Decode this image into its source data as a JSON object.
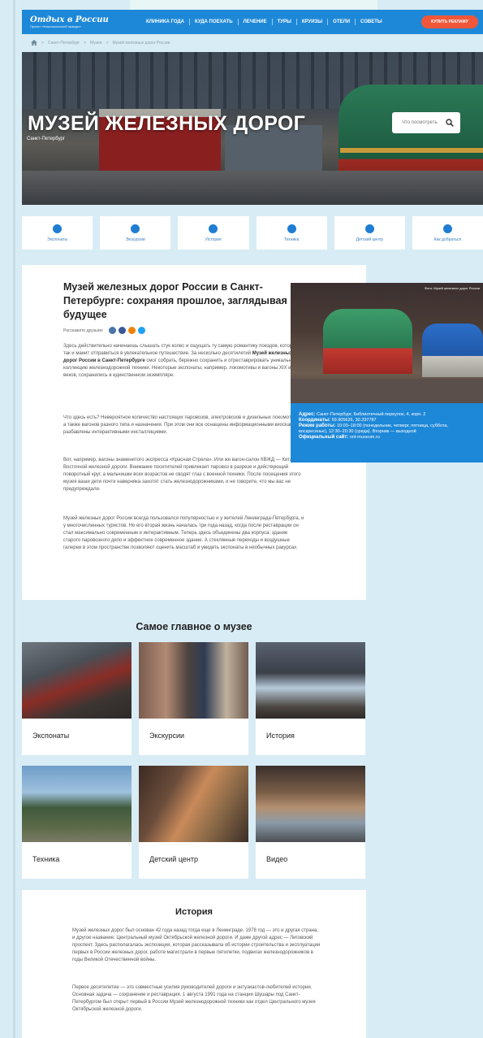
{
  "header": {
    "logo_title": "Отдых в России",
    "logo_sub": "Проект «Комсомольской правды»",
    "nav": [
      "КЛИНИКА ГОДА",
      "КУДА ПОЕХАТЬ",
      "ЛЕЧЕНИЕ",
      "ТУРЫ",
      "КРУИЗЫ",
      "ОТЕЛИ",
      "СОВЕТЫ"
    ],
    "ad_button": "КУПИТЬ РЕКЛАМУ"
  },
  "breadcrumbs": [
    "Санкт-Петербург",
    "Музеи",
    "Музей железных дорог России"
  ],
  "hero": {
    "title": "МУЗЕЙ ЖЕЛЕЗНЫХ ДОРОГ",
    "city": "Санкт-Петербург",
    "search_placeholder": "Что посмотреть"
  },
  "tiles": [
    "Экспонаты",
    "Экскурсии",
    "История",
    "Техника",
    "Детский центр",
    "Как добраться"
  ],
  "article": {
    "title": "Музей железных дорог России в Санкт-Петербурге: сохраняя прошлое, заглядывая в будущее",
    "share_label": "Расскажите друзьям:",
    "p1_start": "Здесь действительно начинаешь слышать стук колес и ощущать ту самую романтику поездов, которая так и манит отправиться в увлекательное путешествие. За несколько десятилетий ",
    "p1_bold": "Музей железных дорог России в Санкт-Петербурге",
    "p1_end": " смог собрать, бережно сохранить и отреставрировать уникальную коллекцию железнодорожной техники. Некоторые экспонаты, например, локомотивы и вагоны XIX и XX веков, сохранились в единственном экземпляре.",
    "p2": "Что здесь есть? Невероятное количество настоящих паровозов, электровозов и дизельных локомотивов, а также вагонов разного типа и назначения. При этом они все оснащены информационными киосками и разбавлены интерактивными инсталляциями.",
    "p3": "Вот, например, вагоны знаменитого экспресса «Красная Стрела». Или же вагон-салон КВЖД — Китайско-Восточной железной дороги. Внимание посетителей привлекает паровоз в разрезе и действующий поворотный круг, а мальчишки всех возрастов не сводят глаз с военной техники. После посещения этого музея ваши дети почти наверняка захотят стать железнодорожниками, и не говорите, что мы вас не предупреждали.",
    "p4": "Музей железных дорог России всегда пользовался популярностью и у жителей Ленинграда-Петербурга, и у многочисленных туристов. Но его вторая жизнь началась три года назад, когда после реставрации он стал максимально современным и интерактивным. Теперь здесь объединены два корпуса: здание старого паровозного депо и эффектное современное здание. А стеклянные переходы и воздушные галереи в этом пространстве позволяют оценить масштаб и увидеть экспонаты в необычных ракурсах."
  },
  "photo": {
    "caption": "Фото: Музей железных дорог России"
  },
  "info": {
    "address_label": "Адрес:",
    "address": "Санкт-Петербург, Библиотечный переулок, 4, корп. 2",
    "coords_label": "Координаты:",
    "coords": "59.905626, 30.297787",
    "hours_label": "Режим работы:",
    "hours": "10:00–18:00 (понедельник, четверг, пятница, суббота, воскресенье), 12:30–20:30 (среда). Вторник — выходной",
    "site_label": "Официальный сайт:",
    "site": "rzd-museum.ru"
  },
  "highlights": {
    "title": "Самое главное о музее",
    "cards": [
      "Экспонаты",
      "Экскурсии",
      "История",
      "Техника",
      "Детский центр",
      "Видео"
    ]
  },
  "history": {
    "title": "История",
    "p1": "Музей железных дорог был основан 42 года назад тогда еще в Ленинграде. 1978 год — это и другая страна, и другое название: Центральный музей Октябрьской железной дороги. И даже другой адрес — Лиговский проспект. Здесь располагалась экспозиция, которая рассказывала об истории строительства и эксплуатации первых в России железных дорог, работе магистрали в первые пятилетки, подвигах железнодорожников в годы Великой Отечественной войны.",
    "p2": "Первое десятилетие — это совместные усилия руководителей дороги и энтузиастов-любителей истории. Основная задача — сохранение и реставрация. 1 августа 1991 года на станции Шушары под Санкт-Петербургом был открыт первый в России Музей железнодорожной техники как отдел Центрального музея Октябрьской железной дороги."
  },
  "colors": {
    "brand_blue": "#1e88d8",
    "ad_red": "#f0573a",
    "page_bg": "#d8ecf5"
  },
  "icons": [
    "home-icon",
    "search-icon",
    "vk-icon",
    "facebook-icon",
    "odnoklassniki-icon",
    "twitter-icon"
  ]
}
